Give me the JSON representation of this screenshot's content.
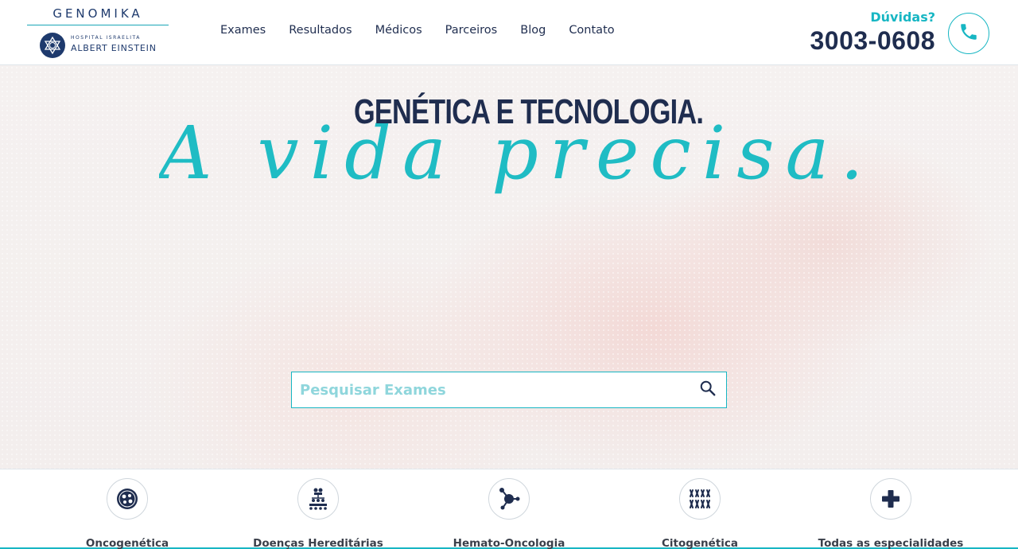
{
  "brand": {
    "top": "GENOMIKA",
    "hospital_small": "HOSPITAL ISRAELITA",
    "hospital_name": "ALBERT EINSTEIN"
  },
  "nav": {
    "items": [
      "Exames",
      "Resultados",
      "Médicos",
      "Parceiros",
      "Blog",
      "Contato"
    ]
  },
  "contact": {
    "question": "Dúvidas?",
    "phone": "3003-0608"
  },
  "hero": {
    "title": "GENÉTICA E TECNOLOGIA.",
    "script": "A vida precisa."
  },
  "search": {
    "placeholder": "Pesquisar Exames"
  },
  "categories": {
    "items": [
      {
        "label": "Oncogenética",
        "icon": "cell-icon"
      },
      {
        "label": "Doenças Hereditárias",
        "icon": "family-tree-icon"
      },
      {
        "label": "Hemato-Oncologia",
        "icon": "molecule-icon"
      },
      {
        "label": "Citogenética",
        "icon": "chromosome-icon"
      },
      {
        "label": "Todas as especialidades",
        "icon": "plus-icon"
      }
    ]
  },
  "colors": {
    "accent": "#17b6c3",
    "navy": "#1f2d4f"
  }
}
